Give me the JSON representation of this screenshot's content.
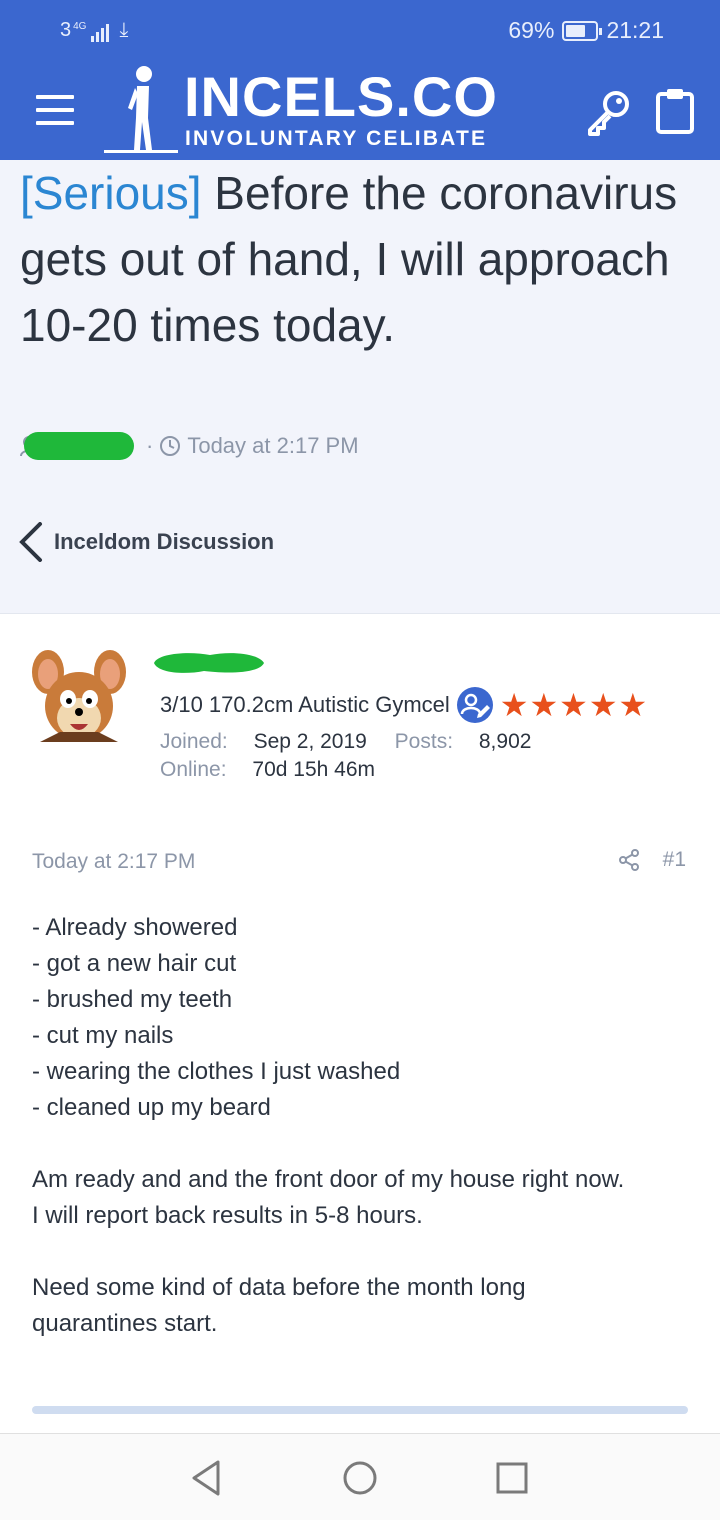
{
  "status_bar": {
    "carrier": "3",
    "network": "4G",
    "battery": "69%",
    "battery_level": 0.69,
    "time": "21:21"
  },
  "app_bar": {
    "logo_title": "INCELS.CO",
    "logo_subtitle": "INVOLUNTARY CELIBATE",
    "menu_icon": "hamburger-icon",
    "login_icon": "key-icon",
    "register_icon": "clipboard-icon",
    "background": "#3b67cf"
  },
  "thread": {
    "prefix": "[Serious]",
    "title": " Before the coronavirus gets out of hand, I will approach 10-20 times today.",
    "author_redacted": true,
    "separator": "·",
    "date": "Today at 2:17 PM",
    "breadcrumb": "Inceldom Discussion"
  },
  "post": {
    "user_title": "3/10 170.2cm Autistic Gymcel",
    "stars": "★★★★★",
    "rating": 5,
    "joined_label": "Joined:",
    "joined_value": "Sep 2, 2019",
    "posts_label": "Posts:",
    "posts_value": "8,902",
    "online_label": "Online:",
    "online_value": "70d 15h 46m",
    "date": "Today at 2:17 PM",
    "number": "#1",
    "body": {
      "list": [
        "- Already showered",
        "- got a new hair cut",
        "- brushed my teeth",
        "- cut my nails",
        "- wearing the clothes I just washed",
        "- cleaned up my beard"
      ],
      "para1_line1": "Am ready and and the front door of my house right now.",
      "para1_line2": "I will report back results in 5-8 hours.",
      "para2_line1": "Need some kind of data before the month long",
      "para2_line2": "quarantines start."
    }
  },
  "colors": {
    "prefix": "#2b86d2",
    "stars": "#e8501c",
    "redaction": "#1fb83a",
    "muted": "#8c96a8"
  }
}
